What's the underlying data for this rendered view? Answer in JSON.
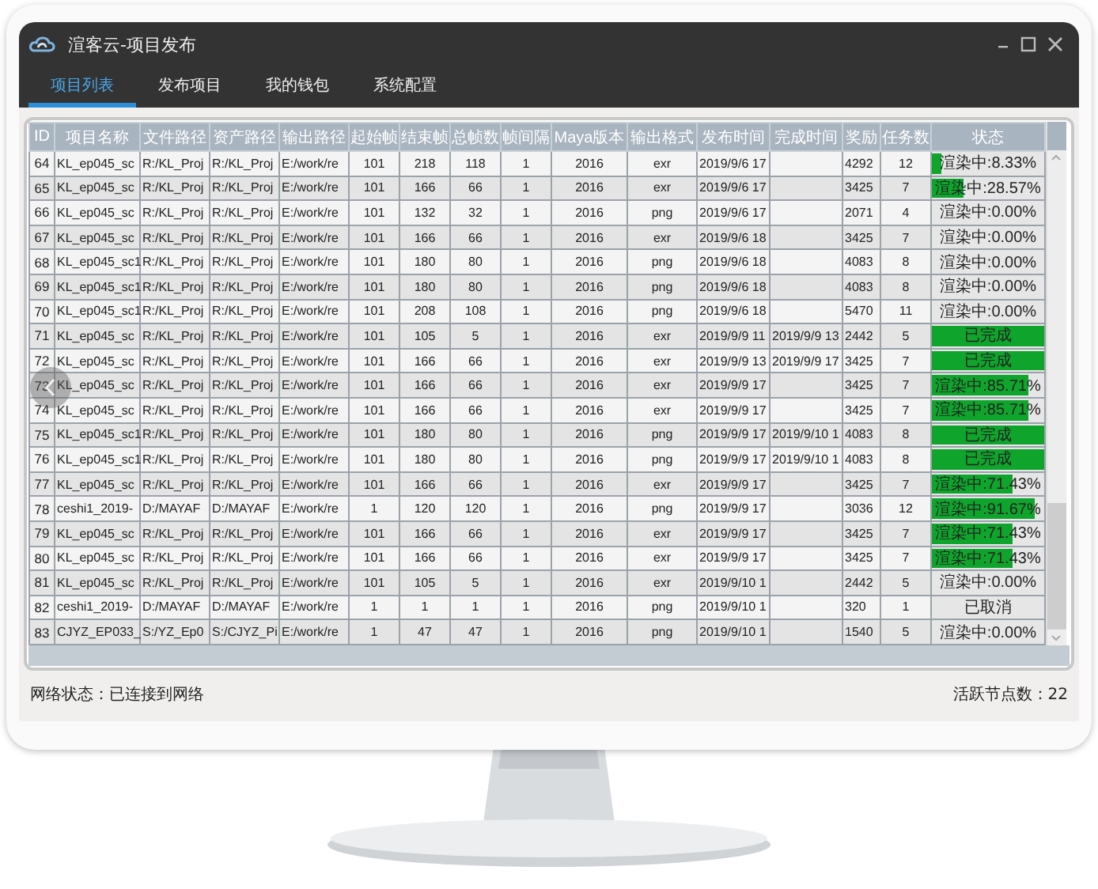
{
  "window": {
    "title": "渲客云-项目发布"
  },
  "tabs": [
    {
      "label": "项目列表",
      "selected": true
    },
    {
      "label": "发布项目",
      "selected": false
    },
    {
      "label": "我的钱包",
      "selected": false
    },
    {
      "label": "系统配置",
      "selected": false
    }
  ],
  "table": {
    "columns": [
      "ID",
      "项目名称",
      "文件路径",
      "资产路径",
      "输出路径",
      "起始帧",
      "结束帧",
      "总帧数",
      "帧间隔",
      "Maya版本",
      "输出格式",
      "发布时间",
      "完成时间",
      "奖励",
      "任务数",
      "状态"
    ],
    "rows": [
      {
        "cells": [
          "64",
          "KL_ep045_sc",
          "R:/KL_Proj",
          "R:/KL_Proj",
          "E:/work/re",
          "101",
          "218",
          "118",
          "1",
          "2016",
          "exr",
          "2019/9/6 17",
          "",
          "4292",
          "12"
        ],
        "status": "渲染中:8.33%",
        "level": 0.0833
      },
      {
        "cells": [
          "65",
          "KL_ep045_sc",
          "R:/KL_Proj",
          "R:/KL_Proj",
          "E:/work/re",
          "101",
          "166",
          "66",
          "1",
          "2016",
          "exr",
          "2019/9/6 17",
          "",
          "3425",
          "7"
        ],
        "status": "渲染中:28.57%",
        "level": 0.2857
      },
      {
        "cells": [
          "66",
          "KL_ep045_sc",
          "R:/KL_Proj",
          "R:/KL_Proj",
          "E:/work/re",
          "101",
          "132",
          "32",
          "1",
          "2016",
          "png",
          "2019/9/6 17",
          "",
          "2071",
          "4"
        ],
        "status": "渲染中:0.00%",
        "level": 0
      },
      {
        "cells": [
          "67",
          "KL_ep045_sc",
          "R:/KL_Proj",
          "R:/KL_Proj",
          "E:/work/re",
          "101",
          "166",
          "66",
          "1",
          "2016",
          "exr",
          "2019/9/6 18",
          "",
          "3425",
          "7"
        ],
        "status": "渲染中:0.00%",
        "level": 0
      },
      {
        "cells": [
          "68",
          "KL_ep045_sc1",
          "R:/KL_Proj",
          "R:/KL_Proj",
          "E:/work/re",
          "101",
          "180",
          "80",
          "1",
          "2016",
          "png",
          "2019/9/6 18",
          "",
          "4083",
          "8"
        ],
        "status": "渲染中:0.00%",
        "level": 0
      },
      {
        "cells": [
          "69",
          "KL_ep045_sc1",
          "R:/KL_Proj",
          "R:/KL_Proj",
          "E:/work/re",
          "101",
          "180",
          "80",
          "1",
          "2016",
          "png",
          "2019/9/6 18",
          "",
          "4083",
          "8"
        ],
        "status": "渲染中:0.00%",
        "level": 0
      },
      {
        "cells": [
          "70",
          "KL_ep045_sc1",
          "R:/KL_Proj",
          "R:/KL_Proj",
          "E:/work/re",
          "101",
          "208",
          "108",
          "1",
          "2016",
          "png",
          "2019/9/6 18",
          "",
          "5470",
          "11"
        ],
        "status": "渲染中:0.00%",
        "level": 0
      },
      {
        "cells": [
          "71",
          "KL_ep045_sc",
          "R:/KL_Proj",
          "R:/KL_Proj",
          "E:/work/re",
          "101",
          "105",
          "5",
          "1",
          "2016",
          "exr",
          "2019/9/9 11",
          "2019/9/9 13",
          "2442",
          "5"
        ],
        "status": "已完成",
        "level": 1
      },
      {
        "cells": [
          "72",
          "KL_ep045_sc",
          "R:/KL_Proj",
          "R:/KL_Proj",
          "E:/work/re",
          "101",
          "166",
          "66",
          "1",
          "2016",
          "exr",
          "2019/9/9 13",
          "2019/9/9 17",
          "3425",
          "7"
        ],
        "status": "已完成",
        "level": 1
      },
      {
        "cells": [
          "73",
          "KL_ep045_sc",
          "R:/KL_Proj",
          "R:/KL_Proj",
          "E:/work/re",
          "101",
          "166",
          "66",
          "1",
          "2016",
          "exr",
          "2019/9/9 17",
          "",
          "3425",
          "7"
        ],
        "status": "渲染中:85.71%",
        "level": 0.8571
      },
      {
        "cells": [
          "74",
          "KL_ep045_sc",
          "R:/KL_Proj",
          "R:/KL_Proj",
          "E:/work/re",
          "101",
          "166",
          "66",
          "1",
          "2016",
          "exr",
          "2019/9/9 17",
          "",
          "3425",
          "7"
        ],
        "status": "渲染中:85.71%",
        "level": 0.8571
      },
      {
        "cells": [
          "75",
          "KL_ep045_sc1",
          "R:/KL_Proj",
          "R:/KL_Proj",
          "E:/work/re",
          "101",
          "180",
          "80",
          "1",
          "2016",
          "png",
          "2019/9/9 17",
          "2019/9/10 1",
          "4083",
          "8"
        ],
        "status": "已完成",
        "level": 1
      },
      {
        "cells": [
          "76",
          "KL_ep045_sc1",
          "R:/KL_Proj",
          "R:/KL_Proj",
          "E:/work/re",
          "101",
          "180",
          "80",
          "1",
          "2016",
          "png",
          "2019/9/9 17",
          "2019/9/10 1",
          "4083",
          "8"
        ],
        "status": "已完成",
        "level": 1
      },
      {
        "cells": [
          "77",
          "KL_ep045_sc",
          "R:/KL_Proj",
          "R:/KL_Proj",
          "E:/work/re",
          "101",
          "166",
          "66",
          "1",
          "2016",
          "exr",
          "2019/9/9 17",
          "",
          "3425",
          "7"
        ],
        "status": "渲染中:71.43%",
        "level": 0.7143
      },
      {
        "cells": [
          "78",
          "ceshi1_2019-",
          "D:/MAYAF",
          "D:/MAYAF",
          "E:/work/re",
          "1",
          "120",
          "120",
          "1",
          "2016",
          "png",
          "2019/9/9 17",
          "",
          "3036",
          "12"
        ],
        "status": "渲染中:91.67%",
        "level": 0.9167
      },
      {
        "cells": [
          "79",
          "KL_ep045_sc",
          "R:/KL_Proj",
          "R:/KL_Proj",
          "E:/work/re",
          "101",
          "166",
          "66",
          "1",
          "2016",
          "exr",
          "2019/9/9 17",
          "",
          "3425",
          "7"
        ],
        "status": "渲染中:71.43%",
        "level": 0.7143
      },
      {
        "cells": [
          "80",
          "KL_ep045_sc",
          "R:/KL_Proj",
          "R:/KL_Proj",
          "E:/work/re",
          "101",
          "166",
          "66",
          "1",
          "2016",
          "exr",
          "2019/9/9 17",
          "",
          "3425",
          "7"
        ],
        "status": "渲染中:71.43%",
        "level": 0.7143
      },
      {
        "cells": [
          "81",
          "KL_ep045_sc",
          "R:/KL_Proj",
          "R:/KL_Proj",
          "E:/work/re",
          "101",
          "105",
          "5",
          "1",
          "2016",
          "exr",
          "2019/9/10 1",
          "",
          "2442",
          "5"
        ],
        "status": "渲染中:0.00%",
        "level": 0
      },
      {
        "cells": [
          "82",
          "ceshi1_2019-",
          "D:/MAYAF",
          "D:/MAYAF",
          "E:/work/re",
          "1",
          "1",
          "1",
          "1",
          "2016",
          "png",
          "2019/9/10 1",
          "",
          "320",
          "1"
        ],
        "status": "已取消",
        "level": 0
      },
      {
        "cells": [
          "83",
          "CJYZ_EP033_",
          "S:/YZ_Ep0",
          "S:/CJYZ_Pi",
          "E:/work/re",
          "1",
          "47",
          "47",
          "1",
          "2016",
          "png",
          "2019/9/10 1",
          "",
          "1540",
          "5"
        ],
        "status": "渲染中:0.00%",
        "level": 0
      }
    ]
  },
  "status_bar": {
    "network": "网络状态：已连接到网络",
    "nodes": "活跃节点数：22"
  }
}
